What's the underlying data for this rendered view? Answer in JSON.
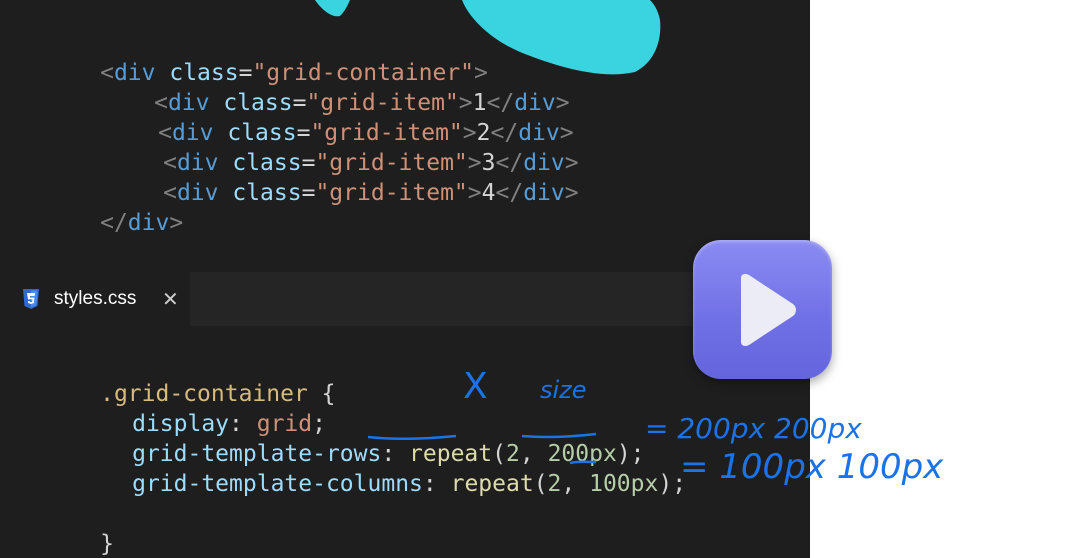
{
  "html_code": {
    "lines": [
      {
        "open": "<",
        "tag": "div",
        "attr": " class",
        "eq": "=",
        "str": "\"grid-container\"",
        "close": ">",
        "text": "",
        "end": ""
      },
      {
        "open": "<",
        "tag": "div",
        "attr": " class",
        "eq": "=",
        "str": "\"grid-item\"",
        "close": ">",
        "text": "1",
        "end_open": "</",
        "end_tag": "div",
        "end_close": ">"
      },
      {
        "open": "<",
        "tag": "div",
        "attr": " class",
        "eq": "=",
        "str": "\"grid-item\"",
        "close": ">",
        "text": "2",
        "end_open": "</",
        "end_tag": "div",
        "end_close": ">"
      },
      {
        "open": "<",
        "tag": "div",
        "attr": " class",
        "eq": "=",
        "str": "\"grid-item\"",
        "close": ">",
        "text": "3",
        "end_open": "</",
        "end_tag": "div",
        "end_close": ">"
      },
      {
        "open": "<",
        "tag": "div",
        "attr": " class",
        "eq": "=",
        "str": "\"grid-item\"",
        "close": ">",
        "text": "4",
        "end_open": "</",
        "end_tag": "div",
        "end_close": ">"
      }
    ],
    "closing": {
      "open": "</",
      "tag": "div",
      "close": ">"
    }
  },
  "tab": {
    "icon": "css3-icon",
    "label": "styles.css",
    "close": "✕"
  },
  "css_code": {
    "selector": ".grid-container",
    "brace_open": " {",
    "decl1": {
      "prop": "display",
      "colon": ": ",
      "val": "grid",
      "semi": ";"
    },
    "decl2": {
      "prop": "grid-template-rows",
      "colon": ": ",
      "fn": "repeat",
      "p1": "(",
      "num1": "2",
      "comma": ", ",
      "num2": "200px",
      "p2": ");"
    },
    "decl3": {
      "prop": "grid-template-columns",
      "colon": ": ",
      "fn": "repeat",
      "p1": "(",
      "num1": "2",
      "comma": ", ",
      "num2": "100px",
      "p2": ");"
    },
    "brace_close": "}"
  },
  "annotations": {
    "x_label": "X",
    "size_label": "size",
    "rows_note": "= 200px  200px",
    "cols_note": "= 100px  100px"
  },
  "play_button": {
    "icon": "play-icon"
  },
  "colors": {
    "editor_bg": "#1e1e1e",
    "accent_play": "#6f6fe6",
    "annotation": "#1a73e8",
    "blob": "#3ad3e0"
  }
}
